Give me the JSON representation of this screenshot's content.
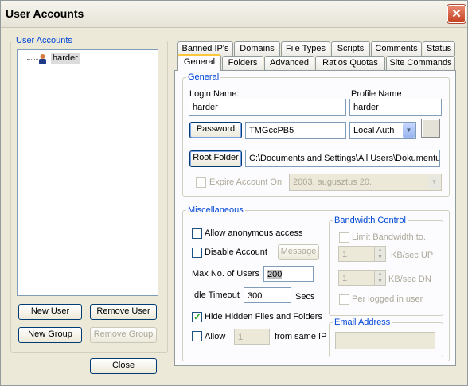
{
  "window": {
    "title": "User Accounts"
  },
  "user_accounts": {
    "legend": "User Accounts",
    "users": [
      {
        "name": "harder"
      }
    ],
    "buttons": {
      "new_user": "New User",
      "remove_user": "Remove User",
      "new_group": "New Group",
      "remove_group": "Remove Group",
      "close": "Close"
    }
  },
  "tabs": {
    "row1": [
      "Banned IP's",
      "Domains",
      "File Types",
      "Scripts",
      "Comments",
      "Status"
    ],
    "row2": [
      "General",
      "Folders",
      "Advanced",
      "Ratios  Quotas",
      "Site Commands"
    ],
    "selected": "General"
  },
  "general": {
    "legend": "General",
    "login_name_label": "Login Name:",
    "login_name_value": "harder",
    "profile_name_label": "Profile Name",
    "profile_name_value": "harder",
    "password_button": "Password",
    "password_value": "TMGccPB5",
    "auth_select": "Local Auth",
    "root_folder_button": "Root Folder",
    "root_folder_value": "C:\\Documents and Settings\\All Users\\Dokumentu",
    "expire_label": "Expire Account On",
    "expire_date": "2003.  augusztus  20."
  },
  "misc": {
    "legend": "Miscellaneous",
    "allow_anonymous": "Allow anonymous access",
    "disable_account": "Disable Account",
    "message_button": "Message",
    "max_users_label": "Max No. of Users",
    "max_users_value": "200",
    "idle_timeout_label": "Idle Timeout",
    "idle_timeout_value": "300",
    "idle_timeout_unit": "Secs",
    "hide_hidden": "Hide Hidden Files and Folders",
    "allow_label": "Allow",
    "allow_value": "1",
    "from_same_ip": "from same IP"
  },
  "bandwidth": {
    "legend": "Bandwidth Control",
    "limit_label": "Limit Bandwidth to..",
    "up_value": "1",
    "up_unit": "KB/sec UP",
    "dn_value": "1",
    "dn_unit": "KB/sec DN",
    "per_user": "Per logged in user"
  },
  "email": {
    "legend": "Email Address",
    "value": ""
  },
  "checkboxes": {
    "expire": false,
    "allow_anonymous": false,
    "disable_account": false,
    "hide_hidden": true,
    "allow": false,
    "limit_bandwidth": false,
    "per_user": false
  }
}
